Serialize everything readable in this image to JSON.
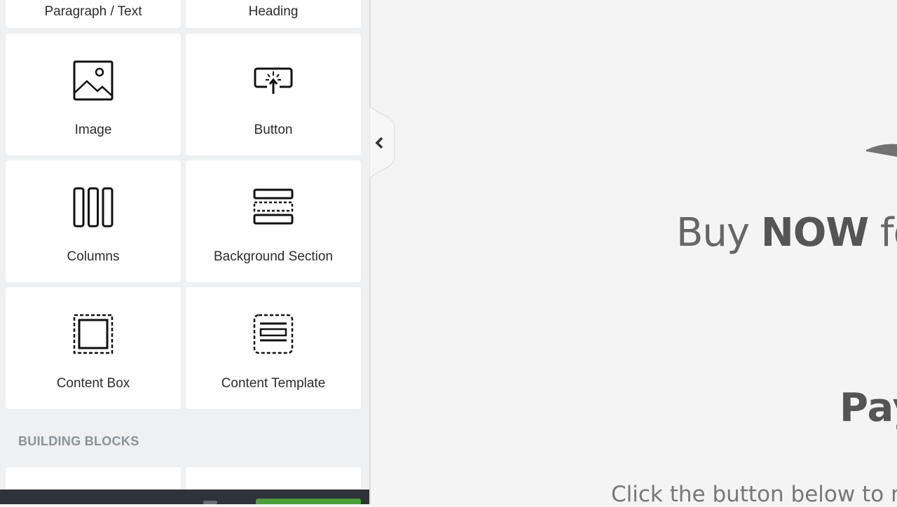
{
  "panel": {
    "tiles": [
      {
        "label": "Paragraph / Text",
        "icon": "paragraph-icon"
      },
      {
        "label": "Heading",
        "icon": "heading-icon"
      },
      {
        "label": "Image",
        "icon": "image-icon"
      },
      {
        "label": "Button",
        "icon": "button-icon"
      },
      {
        "label": "Columns",
        "icon": "columns-icon"
      },
      {
        "label": "Background Section",
        "icon": "background-section-icon"
      },
      {
        "label": "Content Box",
        "icon": "content-box-icon"
      },
      {
        "label": "Content Template",
        "icon": "content-template-icon"
      }
    ],
    "section_title": "BUILDING BLOCKS",
    "collapse_icon": "chevron-left-icon"
  },
  "canvas": {
    "headline_prefix": "Buy ",
    "headline_bold": "NOW",
    "headline_suffix": " fo",
    "subheading": "Pay",
    "body_text": "Click the button below to r"
  },
  "colors": {
    "panel_bg": "#eef0f1",
    "tile_bg": "#ffffff",
    "canvas_bg": "#f4f4f4",
    "bottom_bar": "#2e3339",
    "primary_button": "#4c9e3a"
  }
}
